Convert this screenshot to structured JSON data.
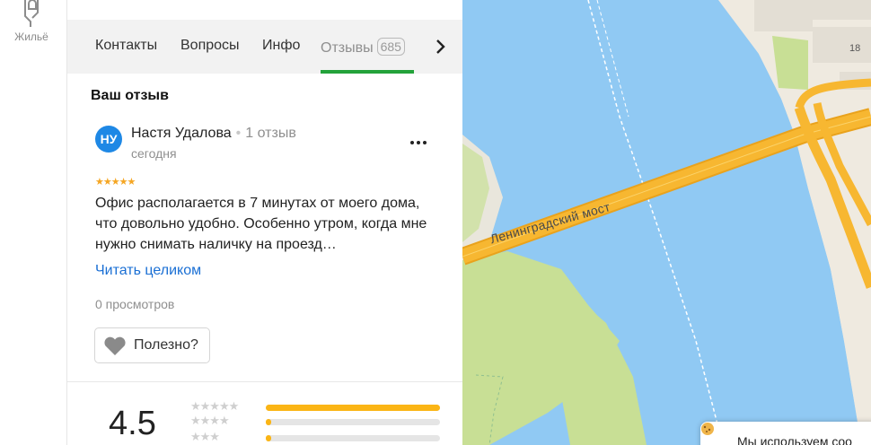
{
  "rail": {
    "housing_label": "Жильё"
  },
  "tabs": [
    {
      "label": "Контакты"
    },
    {
      "label": "Вопросы"
    },
    {
      "label": "Инфо"
    },
    {
      "label": "Отзывы",
      "count": "685",
      "active": true
    }
  ],
  "review_section": {
    "title": "Ваш отзыв"
  },
  "review": {
    "avatar_initials": "НУ",
    "author": "Настя Удалова",
    "author_separator": "•",
    "author_reviews": "1 отзыв",
    "date": "сегодня",
    "rating_stars": "★★★★★",
    "rating": 5,
    "text": "Офис располагается в 7 минутах от моего дома, что довольно удобно. Особенно утром, когда мне нужно снимать наличку на проезд…",
    "read_more": "Читать целиком",
    "views": "0 просмотров",
    "useful_label": "Полезно?"
  },
  "rating_summary": {
    "average": "4.5",
    "rows": [
      {
        "stars": "★★★★★",
        "fraction": 1.0
      },
      {
        "stars": "★★★★",
        "fraction": 0.03
      },
      {
        "stars": "★★★",
        "fraction": 0.03
      }
    ]
  },
  "map": {
    "bridge_label": "Ленинградский мост",
    "house_number": "18",
    "cookie_text": "Мы используем coo",
    "colors": {
      "water": "#90c9f3",
      "land": "#efeae0",
      "green": "#c8df95",
      "road": "#f7b731"
    }
  },
  "colors": {
    "accent_green": "#23a23a",
    "link_blue": "#1a6fd4",
    "avatar_blue": "#1e88e5",
    "star_orange": "#f5a623",
    "bar_yellow": "#fbb515"
  }
}
